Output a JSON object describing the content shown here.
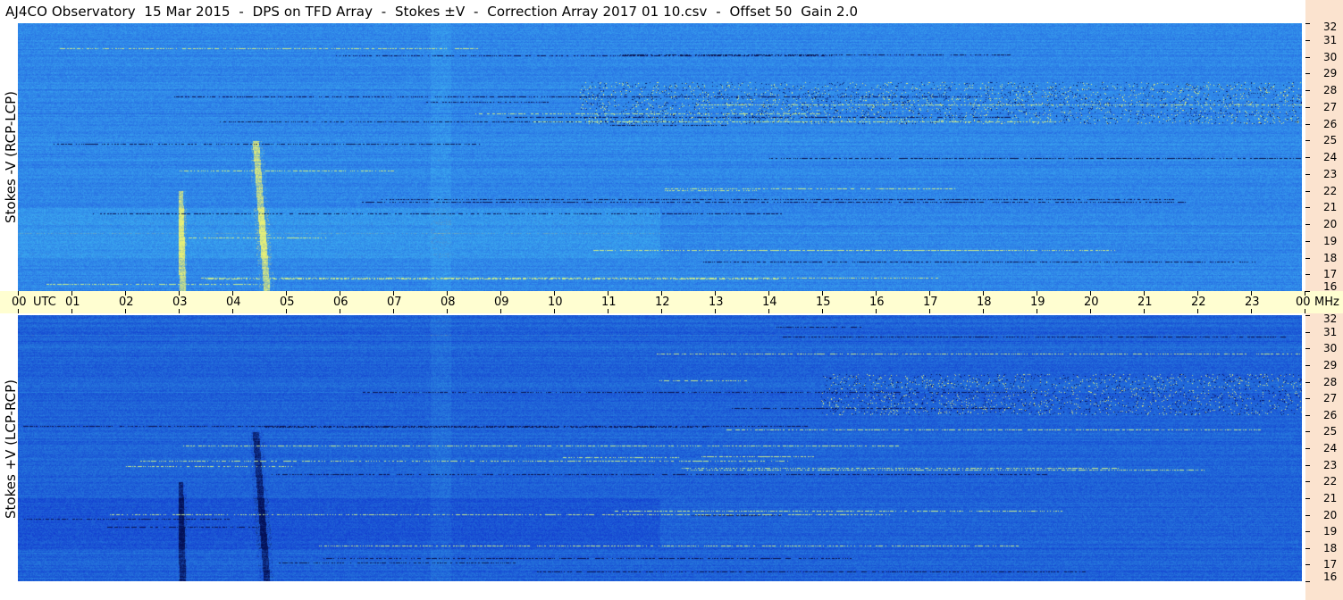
{
  "title": "AJ4CO Observatory  15 Mar 2015  -  DPS on TFD Array  -  Stokes ±V  -  Correction Array 2017 01 10.csv  -  Offset 50  Gain 2.0",
  "panels": {
    "top_ylabel": "Stokes -V (RCP-LCP)",
    "bottom_ylabel": "Stokes +V (LCP-RCP)"
  },
  "time_axis": {
    "utc_label": "UTC",
    "mhz_label": "MHz",
    "hour_labels": [
      "00",
      "01",
      "02",
      "03",
      "04",
      "05",
      "06",
      "07",
      "08",
      "09",
      "10",
      "11",
      "12",
      "13",
      "14",
      "15",
      "16",
      "17",
      "18",
      "19",
      "20",
      "21",
      "22",
      "23",
      "00"
    ]
  },
  "freq_axis": {
    "labels": [
      "32",
      "31",
      "30",
      "29",
      "28",
      "27",
      "26",
      "25",
      "24",
      "23",
      "22",
      "21",
      "20",
      "19",
      "18",
      "17",
      "16"
    ]
  },
  "colors": {
    "scale_background": "#fbe3cf",
    "timebar_background": "#fffed1",
    "spectrogram_base": "#2a7de0",
    "minus_v_base": "#2f86e8",
    "plus_v_base": "#1f63d8"
  },
  "chart_data": {
    "type": "heatmap",
    "title": "AJ4CO Observatory  15 Mar 2015  -  DPS on TFD Array  -  Stokes ±V  -  Correction Array 2017 01 10.csv  -  Offset 50  Gain 2.0",
    "xlabel": "UTC",
    "ylabel": "MHz",
    "x_range_utc_hours": [
      0,
      24
    ],
    "y_range_mhz": [
      16,
      32
    ],
    "panels": [
      {
        "name": "Stokes -V (RCP-LCP)",
        "events": [
          {
            "kind": "burst",
            "utc_start": 3.0,
            "utc_end": 3.15,
            "mhz_low": 16,
            "mhz_high": 22
          },
          {
            "kind": "burst",
            "utc_start": 4.35,
            "utc_end": 4.95,
            "mhz_low": 16,
            "mhz_high": 25
          },
          {
            "kind": "interference_band",
            "utc_start": 10.5,
            "utc_end": 24.0,
            "mhz_low": 26,
            "mhz_high": 28.5
          },
          {
            "kind": "gap",
            "utc_start": 7.7,
            "utc_end": 8.1,
            "mhz_low": 16,
            "mhz_high": 32
          }
        ]
      },
      {
        "name": "Stokes +V (LCP-RCP)",
        "events": [
          {
            "kind": "burst",
            "utc_start": 3.0,
            "utc_end": 3.15,
            "mhz_low": 16,
            "mhz_high": 22
          },
          {
            "kind": "burst",
            "utc_start": 4.35,
            "utc_end": 4.95,
            "mhz_low": 16,
            "mhz_high": 25
          },
          {
            "kind": "interference_band",
            "utc_start": 15.0,
            "utc_end": 24.0,
            "mhz_low": 26,
            "mhz_high": 28.5
          },
          {
            "kind": "gap",
            "utc_start": 7.7,
            "utc_end": 8.1,
            "mhz_low": 16,
            "mhz_high": 32
          }
        ]
      }
    ]
  }
}
